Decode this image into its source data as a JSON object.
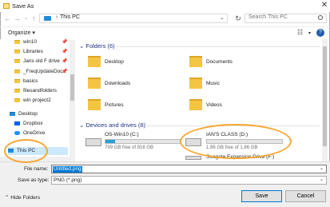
{
  "window": {
    "title": "Save As"
  },
  "address": {
    "path": "This PC",
    "search_placeholder": "Search This PC"
  },
  "toolbar": {
    "organize": "Organize ▾"
  },
  "nav": [
    {
      "label": "win10",
      "pinned": true
    },
    {
      "label": "Libraries",
      "pinned": true
    },
    {
      "label": "Jans old F drive",
      "pinned": true
    },
    {
      "label": "_FreqUpdateDocs",
      "pinned": true
    },
    {
      "label": "basics",
      "pinned": false
    },
    {
      "label": "filesandfolders",
      "pinned": false
    },
    {
      "label": "win project2",
      "pinned": false
    },
    {
      "label": "Desktop",
      "pinned": false
    },
    {
      "label": "Dropbox",
      "pinned": false
    },
    {
      "label": "OneDrive",
      "pinned": false
    },
    {
      "label": "This PC",
      "pinned": false,
      "selected": true
    }
  ],
  "folders_header": "Folders (6)",
  "folders": [
    "Desktop",
    "Documents",
    "Downloads",
    "Music",
    "Pictures",
    "Videos"
  ],
  "drives_header": "Devices and drives (8)",
  "drives": [
    {
      "name": "OS-Win10 (C:)",
      "free": "799 GB free of 916 GB",
      "used_fraction": 0.13
    },
    {
      "name": "IAN'S CLASS (D:)",
      "free": "1.86 GB free of 1.86 GB",
      "used_fraction": 0.0
    },
    {
      "name": "Seagate Expansion Drive (F:)"
    }
  ],
  "bottom": {
    "file_name_label": "File name:",
    "file_name_value": "Untitled.png",
    "save_as_type_label": "Save as type:",
    "save_as_type_value": "PNG (*.png)",
    "hide_folders": "Hide Folders",
    "save": "Save",
    "cancel": "Cancel"
  },
  "colors": {
    "accent": "#0078d7",
    "highlight": "#f6a731",
    "group_header": "#1e3287"
  }
}
